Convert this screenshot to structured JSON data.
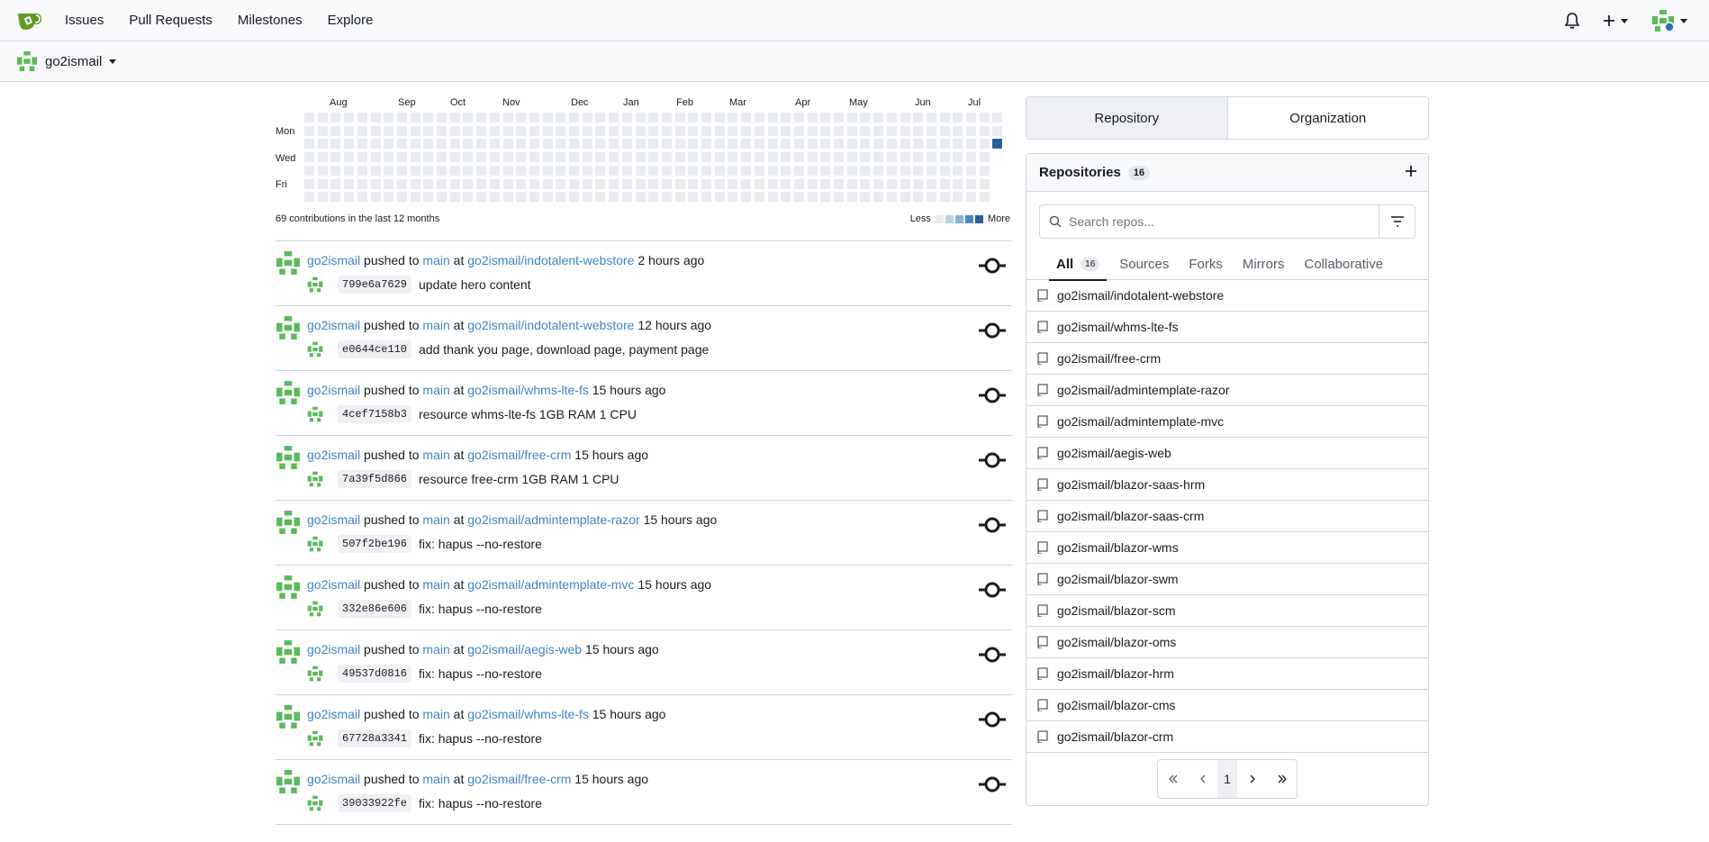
{
  "nav": {
    "links": [
      "Issues",
      "Pull Requests",
      "Milestones",
      "Explore"
    ]
  },
  "context": {
    "user": "go2ismail"
  },
  "heatmap": {
    "months": [
      "Aug",
      "Sep",
      "Oct",
      "Nov",
      "Dec",
      "Jan",
      "Feb",
      "Mar",
      "Apr",
      "May",
      "Jun",
      "Jul"
    ],
    "days": [
      "Mon",
      "Wed",
      "Fri"
    ],
    "summary": "69 contributions in the last 12 months",
    "legend_less": "Less",
    "legend_more": "More",
    "colors": [
      "#e8ebef",
      "#bcd0e6",
      "#8ab0d8",
      "#4f86be",
      "#2b5f98"
    ]
  },
  "feed": [
    {
      "user": "go2ismail",
      "verb": "pushed to",
      "branch": "main",
      "at": "at",
      "repo": "go2ismail/indotalent-webstore",
      "time": "2 hours ago",
      "sha": "799e6a7629",
      "message": "update hero content"
    },
    {
      "user": "go2ismail",
      "verb": "pushed to",
      "branch": "main",
      "at": "at",
      "repo": "go2ismail/indotalent-webstore",
      "time": "12 hours ago",
      "sha": "e0644ce110",
      "message": "add thank you page, download page, payment page"
    },
    {
      "user": "go2ismail",
      "verb": "pushed to",
      "branch": "main",
      "at": "at",
      "repo": "go2ismail/whms-lte-fs",
      "time": "15 hours ago",
      "sha": "4cef7158b3",
      "message": "resource whms-lte-fs 1GB RAM 1 CPU"
    },
    {
      "user": "go2ismail",
      "verb": "pushed to",
      "branch": "main",
      "at": "at",
      "repo": "go2ismail/free-crm",
      "time": "15 hours ago",
      "sha": "7a39f5d866",
      "message": "resource free-crm 1GB RAM 1 CPU"
    },
    {
      "user": "go2ismail",
      "verb": "pushed to",
      "branch": "main",
      "at": "at",
      "repo": "go2ismail/admintemplate-razor",
      "time": "15 hours ago",
      "sha": "507f2be196",
      "message": "fix: hapus --no-restore"
    },
    {
      "user": "go2ismail",
      "verb": "pushed to",
      "branch": "main",
      "at": "at",
      "repo": "go2ismail/admintemplate-mvc",
      "time": "15 hours ago",
      "sha": "332e86e606",
      "message": "fix: hapus --no-restore"
    },
    {
      "user": "go2ismail",
      "verb": "pushed to",
      "branch": "main",
      "at": "at",
      "repo": "go2ismail/aegis-web",
      "time": "15 hours ago",
      "sha": "49537d0816",
      "message": "fix: hapus --no-restore"
    },
    {
      "user": "go2ismail",
      "verb": "pushed to",
      "branch": "main",
      "at": "at",
      "repo": "go2ismail/whms-lte-fs",
      "time": "15 hours ago",
      "sha": "67728a3341",
      "message": "fix: hapus --no-restore"
    },
    {
      "user": "go2ismail",
      "verb": "pushed to",
      "branch": "main",
      "at": "at",
      "repo": "go2ismail/free-crm",
      "time": "15 hours ago",
      "sha": "39033922fe",
      "message": "fix: hapus --no-restore"
    }
  ],
  "dashboard": {
    "tab_repository": "Repository",
    "tab_organization": "Organization",
    "repos_title": "Repositories",
    "repos_count": "16",
    "search_placeholder": "Search repos...",
    "subtabs": [
      "All",
      "Sources",
      "Forks",
      "Mirrors",
      "Collaborative"
    ],
    "all_count": "16",
    "repos": [
      "go2ismail/indotalent-webstore",
      "go2ismail/whms-lte-fs",
      "go2ismail/free-crm",
      "go2ismail/admintemplate-razor",
      "go2ismail/admintemplate-mvc",
      "go2ismail/aegis-web",
      "go2ismail/blazor-saas-hrm",
      "go2ismail/blazor-saas-crm",
      "go2ismail/blazor-wms",
      "go2ismail/blazor-swm",
      "go2ismail/blazor-scm",
      "go2ismail/blazor-oms",
      "go2ismail/blazor-hrm",
      "go2ismail/blazor-cms",
      "go2ismail/blazor-crm"
    ],
    "page": "1"
  }
}
